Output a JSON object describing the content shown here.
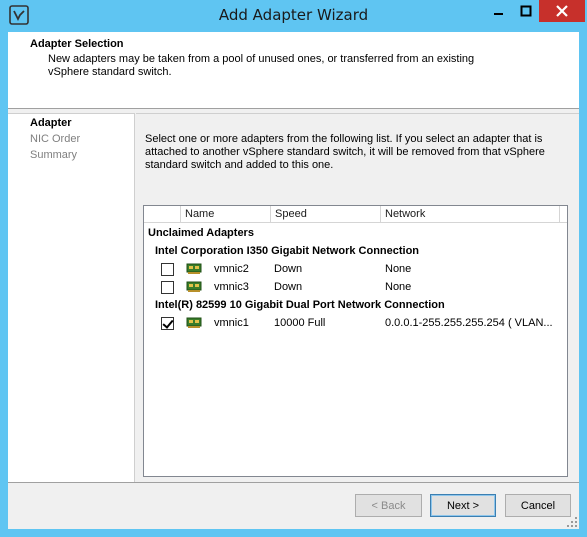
{
  "window": {
    "title": "Add Adapter Wizard"
  },
  "header": {
    "title": "Adapter Selection",
    "description": "New adapters may be taken from a pool of unused ones, or transferred from an existing vSphere standard switch."
  },
  "nav": {
    "items": [
      {
        "label": "Adapter",
        "active": true
      },
      {
        "label": "NIC Order",
        "active": false
      },
      {
        "label": "Summary",
        "active": false
      }
    ]
  },
  "content": {
    "instructions": "Select one or more adapters from the following list. If you select an adapter that is attached to another vSphere standard switch, it will be removed from that vSphere standard switch and added to this one.",
    "columns": [
      "Name",
      "Speed",
      "Network"
    ],
    "group_title": "Unclaimed Adapters",
    "sections": [
      {
        "title": "Intel Corporation I350 Gigabit Network Connection",
        "adapters": [
          {
            "name": "vmnic2",
            "speed": "Down",
            "network": "None",
            "checked": false
          },
          {
            "name": "vmnic3",
            "speed": "Down",
            "network": "None",
            "checked": false
          }
        ]
      },
      {
        "title": "Intel(R) 82599 10 Gigabit Dual Port Network Connection",
        "adapters": [
          {
            "name": "vmnic1",
            "speed": "10000 Full",
            "network": "0.0.0.1-255.255.255.254 ( VLAN...",
            "checked": true
          }
        ]
      }
    ]
  },
  "footer": {
    "back_label": "< Back",
    "next_label": "Next >",
    "cancel_label": "Cancel"
  }
}
